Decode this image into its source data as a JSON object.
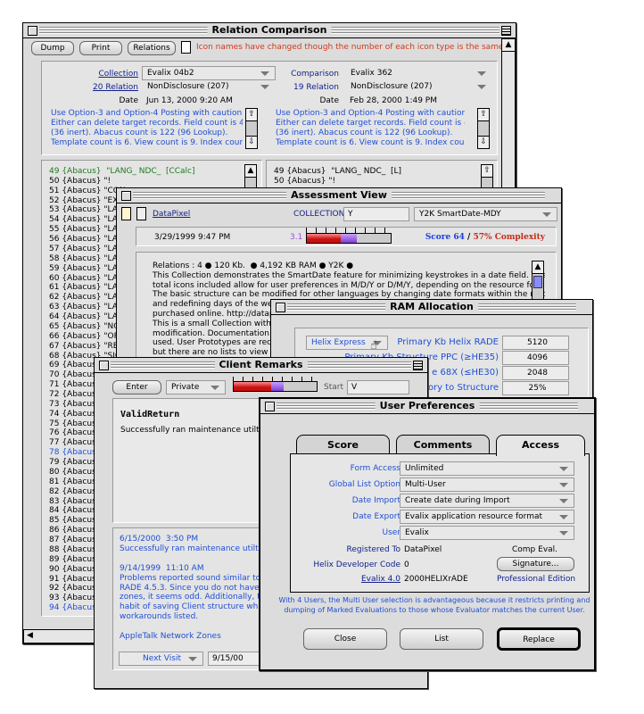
{
  "relation": {
    "title": "Relation Comparison",
    "buttons": [
      "Dump",
      "Print",
      "Relations"
    ],
    "notice": "Icon names have changed though the number of each icon type is the same.",
    "notice_color": "#d23a1a",
    "left": {
      "collection_label": "Collection",
      "collection": "Evalix 04b2",
      "relation_label": "20 Relation",
      "relation": "NonDisclosure (207)",
      "date_label": "Date",
      "date": "Jun 13, 2000  9:20 AM",
      "note": "Use Option-3 and Option-4 Posting with caution.\nEither can delete target records. Field count is 48\n(36 inert). Abacus count is 122 (96 Lookup).\nTemplate count is 6. View count is 9. Index count is"
    },
    "right": {
      "collection_label": "Comparison",
      "collection": "Evalix 362",
      "relation_label": "19 Relation",
      "relation": "NonDisclosure (207)",
      "date_label": "Date",
      "date": "Feb 28, 2000  1:49 PM",
      "note": "Use Option-3 and Option-4 Posting with caution.\nEither can delete target records. Field count is 48\n(36 inert). Abacus count is 122 (96 Lookup).\nTemplate count is 6. View count is 9. Index count is"
    },
    "left_list": [
      {
        "t": "49 {Abacus}  \"LANG_ NDC_  [CCalc]",
        "c": "#1d7a1d"
      },
      {
        "t": "50 {Abacus} \"!"
      },
      {
        "t": "51 {Abacus} \"CON"
      },
      {
        "t": "52 {Abacus} \"EXP"
      },
      {
        "t": "53 {Abacus} \"LAN"
      },
      {
        "t": "54 {Abacus} \"LAN"
      },
      {
        "t": "55 {Abacus} \"LAN"
      },
      {
        "t": "56 {Abacus} \"LAN"
      },
      {
        "t": "57 {Abacus} \"LAN"
      },
      {
        "t": "58 {Abacus} \"LAN"
      },
      {
        "t": "59 {Abacus} \"LAN"
      },
      {
        "t": "60 {Abacus} \"LAN"
      },
      {
        "t": "61 {Abacus} \"LAN"
      },
      {
        "t": "62 {Abacus} \"LAN"
      },
      {
        "t": "63 {Abacus} \"LAN"
      },
      {
        "t": "64 {Abacus} \"LAN"
      },
      {
        "t": "65 {Abacus} \"NON"
      },
      {
        "t": "66 {Abacus} \"ORIG"
      },
      {
        "t": "67 {Abacus} \"RECI"
      },
      {
        "t": "68 {Abacus} \"SIGN"
      },
      {
        "t": "69 {Abacus}"
      },
      {
        "t": "70 {Abacus}"
      },
      {
        "t": "71 {Abacus}"
      },
      {
        "t": "72 {Abacus}"
      },
      {
        "t": "73 {Abacus}"
      },
      {
        "t": "74 {Abacus}"
      },
      {
        "t": "75 {Abacus}"
      },
      {
        "t": "76 {Abacus}"
      },
      {
        "t": "77 {Abacus}"
      },
      {
        "t": "78 {Abacus}",
        "c": "#1f4fd6"
      },
      {
        "t": "79 {Abacus}"
      },
      {
        "t": "80 {Abacus}"
      },
      {
        "t": "81 {Abacus}"
      },
      {
        "t": "82 {Abacus}"
      },
      {
        "t": "83 {Abacus}"
      },
      {
        "t": "84 {Abacus}"
      },
      {
        "t": "85 {Abacus}"
      },
      {
        "t": "86 {Abacus}"
      },
      {
        "t": "87 {Abacus}"
      },
      {
        "t": "88 {Abacus}"
      },
      {
        "t": "89 {Abacus}"
      },
      {
        "t": "90 {Abacus}"
      },
      {
        "t": "91 {Abacus}"
      },
      {
        "t": "92 {Abacus}"
      },
      {
        "t": "93 {Abacus}"
      },
      {
        "t": "94 {Abacus}",
        "c": "#1f4fd6"
      }
    ],
    "right_list": [
      {
        "t": "49 {Abacus}  \"LANG_ NDC_  [L]"
      },
      {
        "t": "50 {Abacus} \"!"
      }
    ]
  },
  "assessment": {
    "title": "Assessment View",
    "owner": "DataPixel",
    "collection_label": "COLLECTION",
    "collection_value": "Y",
    "template": "Y2K SmartDate-MDY",
    "datetime": "3/29/1999  9:47 PM",
    "rating": "3.1",
    "rating_fill_percent": 40,
    "rating_purple_percent": 20,
    "score": "Score 64",
    "sep": " / ",
    "complexity": "57% Complexity",
    "body": "Relations : 4 ● 120 Kb.  ● 4,192 KB RAM ● Y2K ●\nThis Collection demonstrates the SmartDate feature for minimizing keystrokes in a date field. The\ntotal icons included allow for user preferences in M/D/Y or D/M/Y, depending on the resource fork.\nThe basic structure can be modified for other languages by changing date formats within the resources\nand redefining days of the week\npurchased online. http://datapi\nThis is a small Collection with a\nmodification. Documentation ma\nused. User Prototypes are reco\nbut there are no lists to view a"
  },
  "ram": {
    "title": "RAM Allocation",
    "mode": "Helix Express",
    "rows": [
      {
        "label": "Primary Kb Helix RADE",
        "value": "5120"
      },
      {
        "label": "Primary Kb Structure PPC (≥HE35)",
        "value": "4096"
      },
      {
        "label": "e 68X (≤HE30)",
        "value": "2048"
      },
      {
        "label": "ory to Structure",
        "value": "25%"
      }
    ]
  },
  "client": {
    "title": "Client Remarks",
    "enter": "Enter",
    "privacy": "Private",
    "progress_percent": 60,
    "purple_percent": 15,
    "start_label": "Start",
    "start_value": "V",
    "heading": "ValidReturn",
    "summary": "Successfully ran maintenance utilti",
    "log": "6/15/2000  3:50 PM\nSuccessfully ran maintenance utilties a\n\n9/14/1999  11:10 AM\nProblems reported sound similar to the\nRADE 4.5.3. Since you do not have that\nzones, it seems odd. Additionally, to m\nhabit of saving Client structure when c\nworkarounds listed.\n\nAppleTalk Network Zones",
    "next_visit": "Next Visit",
    "next_date": "9/15/00"
  },
  "prefs": {
    "title": "User Preferences",
    "tabs": [
      "Score",
      "Comments",
      "Access"
    ],
    "active_tab": "Access",
    "fields": [
      {
        "label": "Form Access",
        "value": "Unlimited"
      },
      {
        "label": "Global List Option",
        "value": "Multi-User"
      },
      {
        "label": "Date Import",
        "value": "Create date during Import"
      },
      {
        "label": "Date Export",
        "value": "Evalix application resource format"
      },
      {
        "label": "User",
        "value": "Evalix"
      }
    ],
    "registered_label": "Registered To",
    "registered": "DataPixel",
    "comp": "Comp Eval.",
    "dev_label": "Helix Developer Code",
    "dev": "0",
    "signature": "Signature...",
    "version_label": "Evalix 4.0",
    "serial": "2000HELIXrADE",
    "edition": "Professional Edition",
    "note": "With 4 Users, the Multi User selection is advantageous because it restricts printing and\ndumping of Marked Evaluations to those whose Evaluator matches the current User.",
    "buttons": {
      "close": "Close",
      "list": "List",
      "replace": "Replace"
    }
  }
}
